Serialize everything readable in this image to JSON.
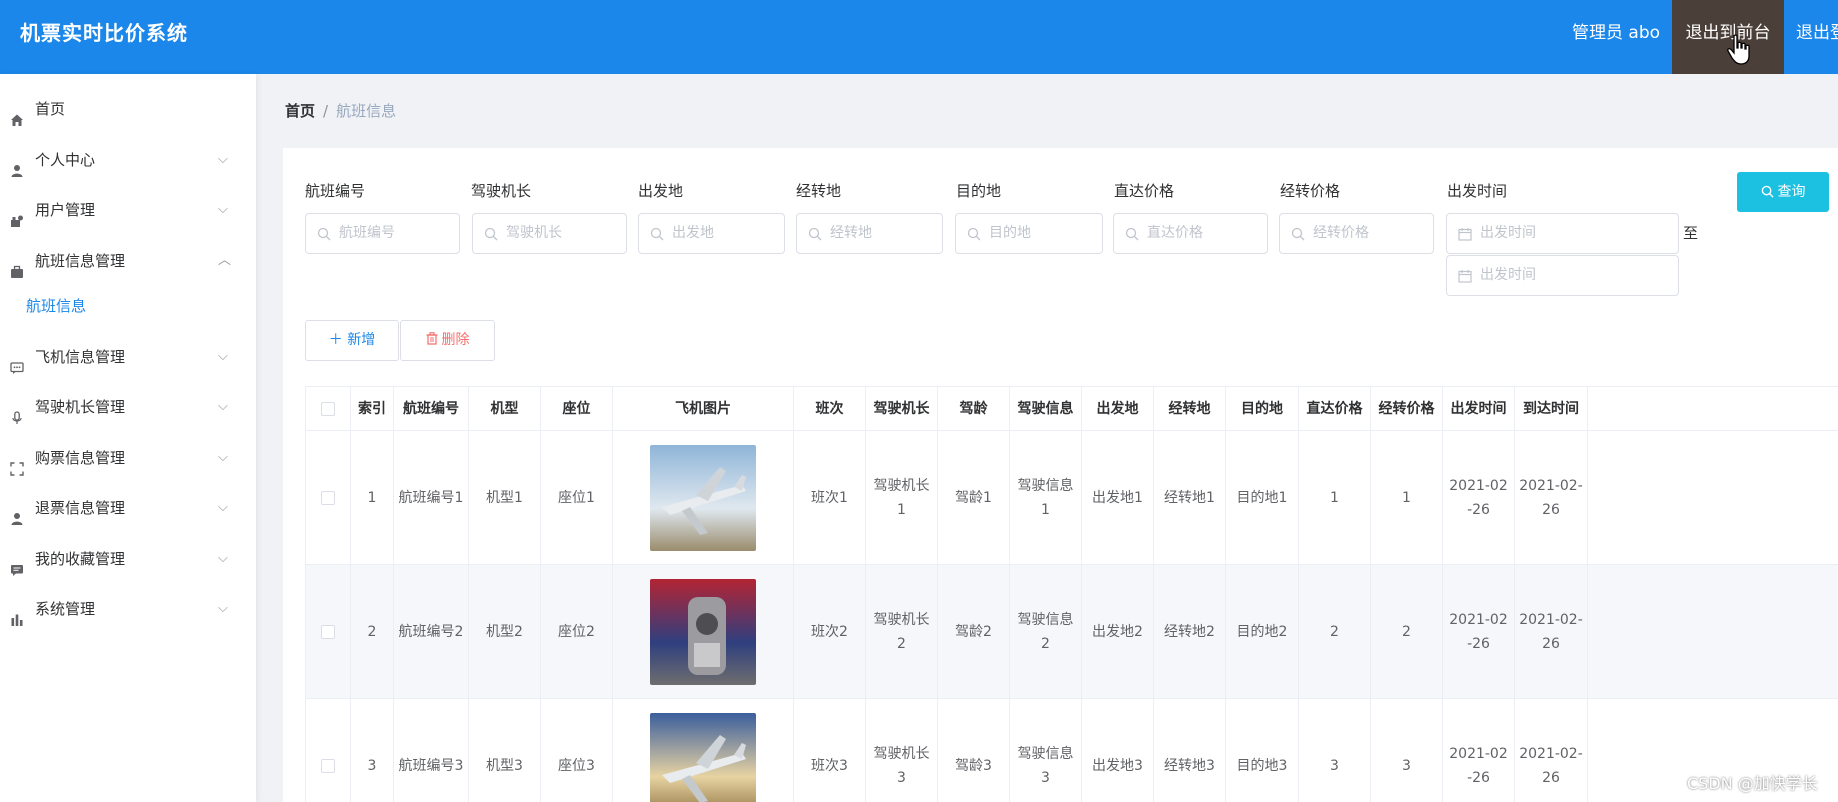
{
  "header": {
    "app_title": "机票实时比价系统",
    "admin_text": "管理员 abo",
    "btn_front": "退出到前台",
    "btn_logout": "退出登录",
    "bg_color": "#1b87ea"
  },
  "sidebar": {
    "items": [
      {
        "label": "首页",
        "icon": "home-icon"
      },
      {
        "label": "个人中心",
        "icon": "person-icon",
        "arrow": "⌵"
      },
      {
        "label": "用户管理",
        "icon": "user-group-icon",
        "arrow": "⌵"
      },
      {
        "label": "航班信息管理",
        "icon": "briefcase-icon",
        "arrow": "︿"
      },
      {
        "label": "航班信息",
        "sub": true
      },
      {
        "label": "飞机信息管理",
        "icon": "chat-icon",
        "arrow": "⌵"
      },
      {
        "label": "驾驶机长管理",
        "icon": "mic-icon",
        "arrow": "⌵"
      },
      {
        "label": "购票信息管理",
        "icon": "frame-icon",
        "arrow": "⌵"
      },
      {
        "label": "退票信息管理",
        "icon": "person-icon",
        "arrow": "⌵"
      },
      {
        "label": "我的收藏管理",
        "icon": "comment-icon",
        "arrow": "⌵"
      },
      {
        "label": "系统管理",
        "icon": "chart-icon",
        "arrow": "⌵"
      }
    ]
  },
  "breadcrumb": {
    "home": "首页",
    "sep": "/",
    "current": "航班信息"
  },
  "filters": [
    {
      "label": "航班编号",
      "placeholder": "航班编号"
    },
    {
      "label": "驾驶机长",
      "placeholder": "驾驶机长"
    },
    {
      "label": "出发地",
      "placeholder": "出发地"
    },
    {
      "label": "经转地",
      "placeholder": "经转地"
    },
    {
      "label": "目的地",
      "placeholder": "目的地"
    },
    {
      "label": "直达价格",
      "placeholder": "直达价格"
    },
    {
      "label": "经转价格",
      "placeholder": "经转价格"
    },
    {
      "label": "出发时间",
      "placeholder": "出发时间"
    }
  ],
  "date_end_placeholder": "出发时间",
  "to_label": "至",
  "search_button": "查询",
  "actions": {
    "add": "新增",
    "delete": "删除"
  },
  "table": {
    "columns": [
      "",
      "索引",
      "航班编号",
      "机型",
      "座位",
      "飞机图片",
      "班次",
      "驾驶机长",
      "驾龄",
      "驾驶信息",
      "出发地",
      "经转地",
      "目的地",
      "直达价格",
      "经转价格",
      "出发时间",
      "到达时间"
    ],
    "rows": [
      {
        "index": "1",
        "flight_no": "航班编号1",
        "model": "机型1",
        "seat": "座位1",
        "image": "plane-photo-1",
        "shift": "班次1",
        "captain": "驾驶机长1",
        "years": "驾龄1",
        "info": "驾驶信息1",
        "from": "出发地1",
        "via": "经转地1",
        "to": "目的地1",
        "direct_price": "1",
        "via_price": "1",
        "depart": "2021-02-26",
        "arrive": "2021-02-26"
      },
      {
        "index": "2",
        "flight_no": "航班编号2",
        "model": "机型2",
        "seat": "座位2",
        "image": "plane-photo-2",
        "shift": "班次2",
        "captain": "驾驶机长2",
        "years": "驾龄2",
        "info": "驾驶信息2",
        "from": "出发地2",
        "via": "经转地2",
        "to": "目的地2",
        "direct_price": "2",
        "via_price": "2",
        "depart": "2021-02-26",
        "arrive": "2021-02-26"
      },
      {
        "index": "3",
        "flight_no": "航班编号3",
        "model": "机型3",
        "seat": "座位3",
        "image": "plane-photo-3",
        "shift": "班次3",
        "captain": "驾驶机长3",
        "years": "驾龄3",
        "info": "驾驶信息3",
        "from": "出发地3",
        "via": "经转地3",
        "to": "目的地3",
        "direct_price": "3",
        "via_price": "3",
        "depart": "2021-02-26",
        "arrive": "2021-02-26"
      }
    ]
  },
  "watermark": "CSDN @加快学长"
}
